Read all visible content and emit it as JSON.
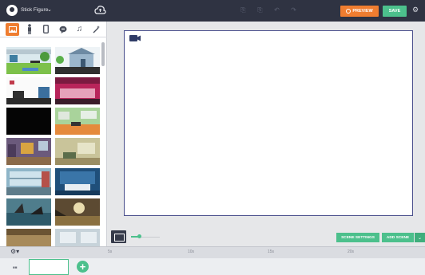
{
  "app": {
    "project_title": "Stick Figure",
    "preview_label": "PREVIEW",
    "save_label": "SAVE"
  },
  "toolbar": {
    "icons": [
      "undo-icon",
      "cut-icon",
      "copy-icon",
      "paste-icon"
    ]
  },
  "library": {
    "categories": [
      {
        "name": "backgrounds",
        "icon": "image-icon",
        "active": true
      },
      {
        "name": "characters",
        "icon": "person-icon",
        "active": false
      },
      {
        "name": "props",
        "icon": "phone-icon",
        "active": false
      },
      {
        "name": "text",
        "icon": "speech-bubble-icon",
        "active": false
      },
      {
        "name": "music",
        "icon": "music-icon",
        "active": false
      },
      {
        "name": "effects",
        "icon": "magic-wand-icon",
        "active": false
      }
    ]
  },
  "scene": {
    "settings_label": "SCENE SETTINGS",
    "add_label": "ADD SCENE"
  },
  "timeline": {
    "ticks": [
      "5s",
      "10s",
      "15s",
      "20s"
    ]
  },
  "colors": {
    "topbar": "#2f3342",
    "accent_orange": "#ef7d30",
    "accent_green": "#4cc08c"
  }
}
